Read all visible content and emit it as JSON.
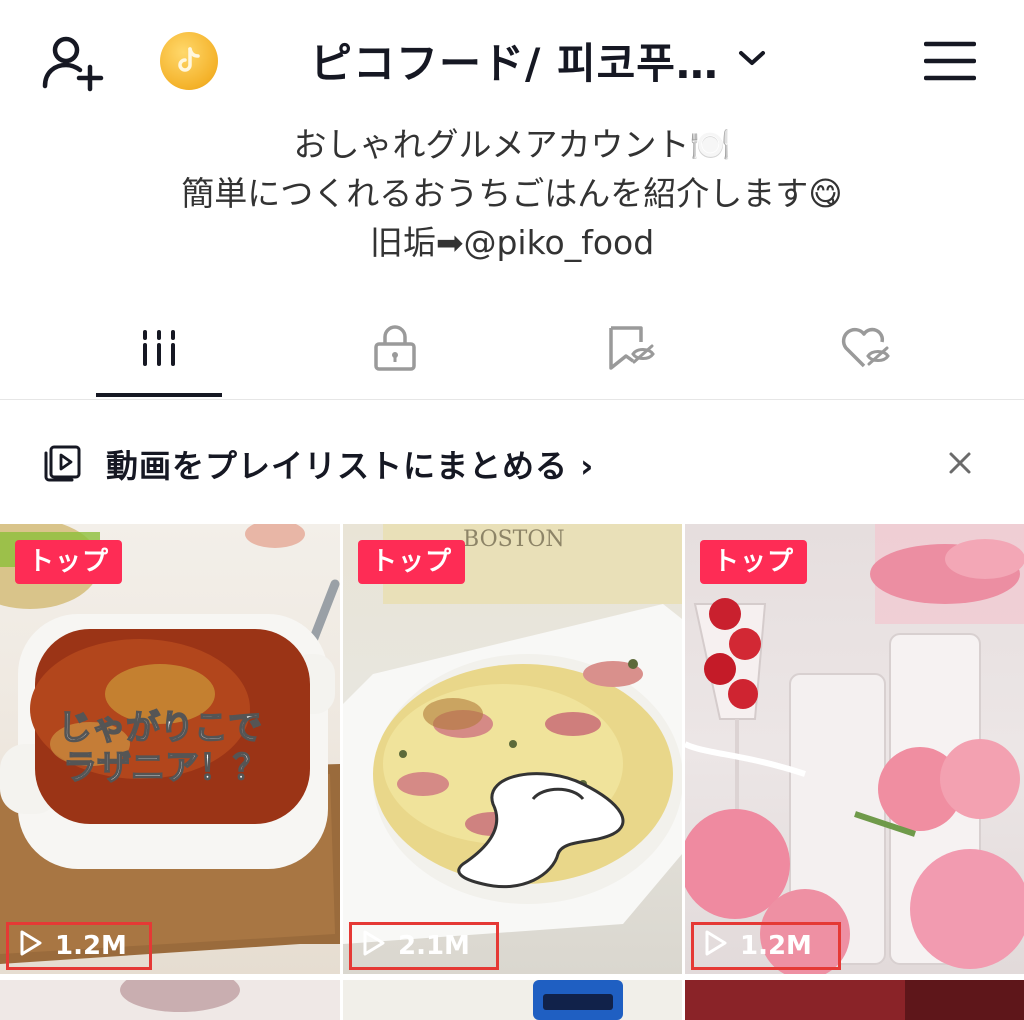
{
  "header": {
    "account_name": "ピコフード/ 피코푸…",
    "add_user_icon": "add-user-icon",
    "coin_icon": "tiktok-coin-icon",
    "dropdown_icon": "chevron-down-icon",
    "menu_icon": "hamburger-menu-icon"
  },
  "bio": {
    "line1": "おしゃれグルメアカウント🍽️",
    "line2": "簡単につくれるおうちごはんを紹介します😋",
    "line3": "旧垢➡@piko_food"
  },
  "tabs": [
    {
      "icon": "videos-grid-icon",
      "active": true
    },
    {
      "icon": "lock-icon",
      "active": false
    },
    {
      "icon": "hidden-favorites-icon",
      "active": false
    },
    {
      "icon": "hidden-likes-icon",
      "active": false
    }
  ],
  "banner": {
    "text": "動画をプレイリストにまとめる ›",
    "icon": "playlist-icon",
    "close_icon": "close-icon"
  },
  "videos": [
    {
      "badge": "トップ",
      "views": "1.2M",
      "caption": "じゃがりこで\nラザニア！？"
    },
    {
      "badge": "トップ",
      "views": "2.1M"
    },
    {
      "badge": "トップ",
      "views": "1.2M"
    }
  ],
  "colors": {
    "badge": "#fe2c55",
    "highlight_box": "#e53935",
    "text": "#161823"
  }
}
